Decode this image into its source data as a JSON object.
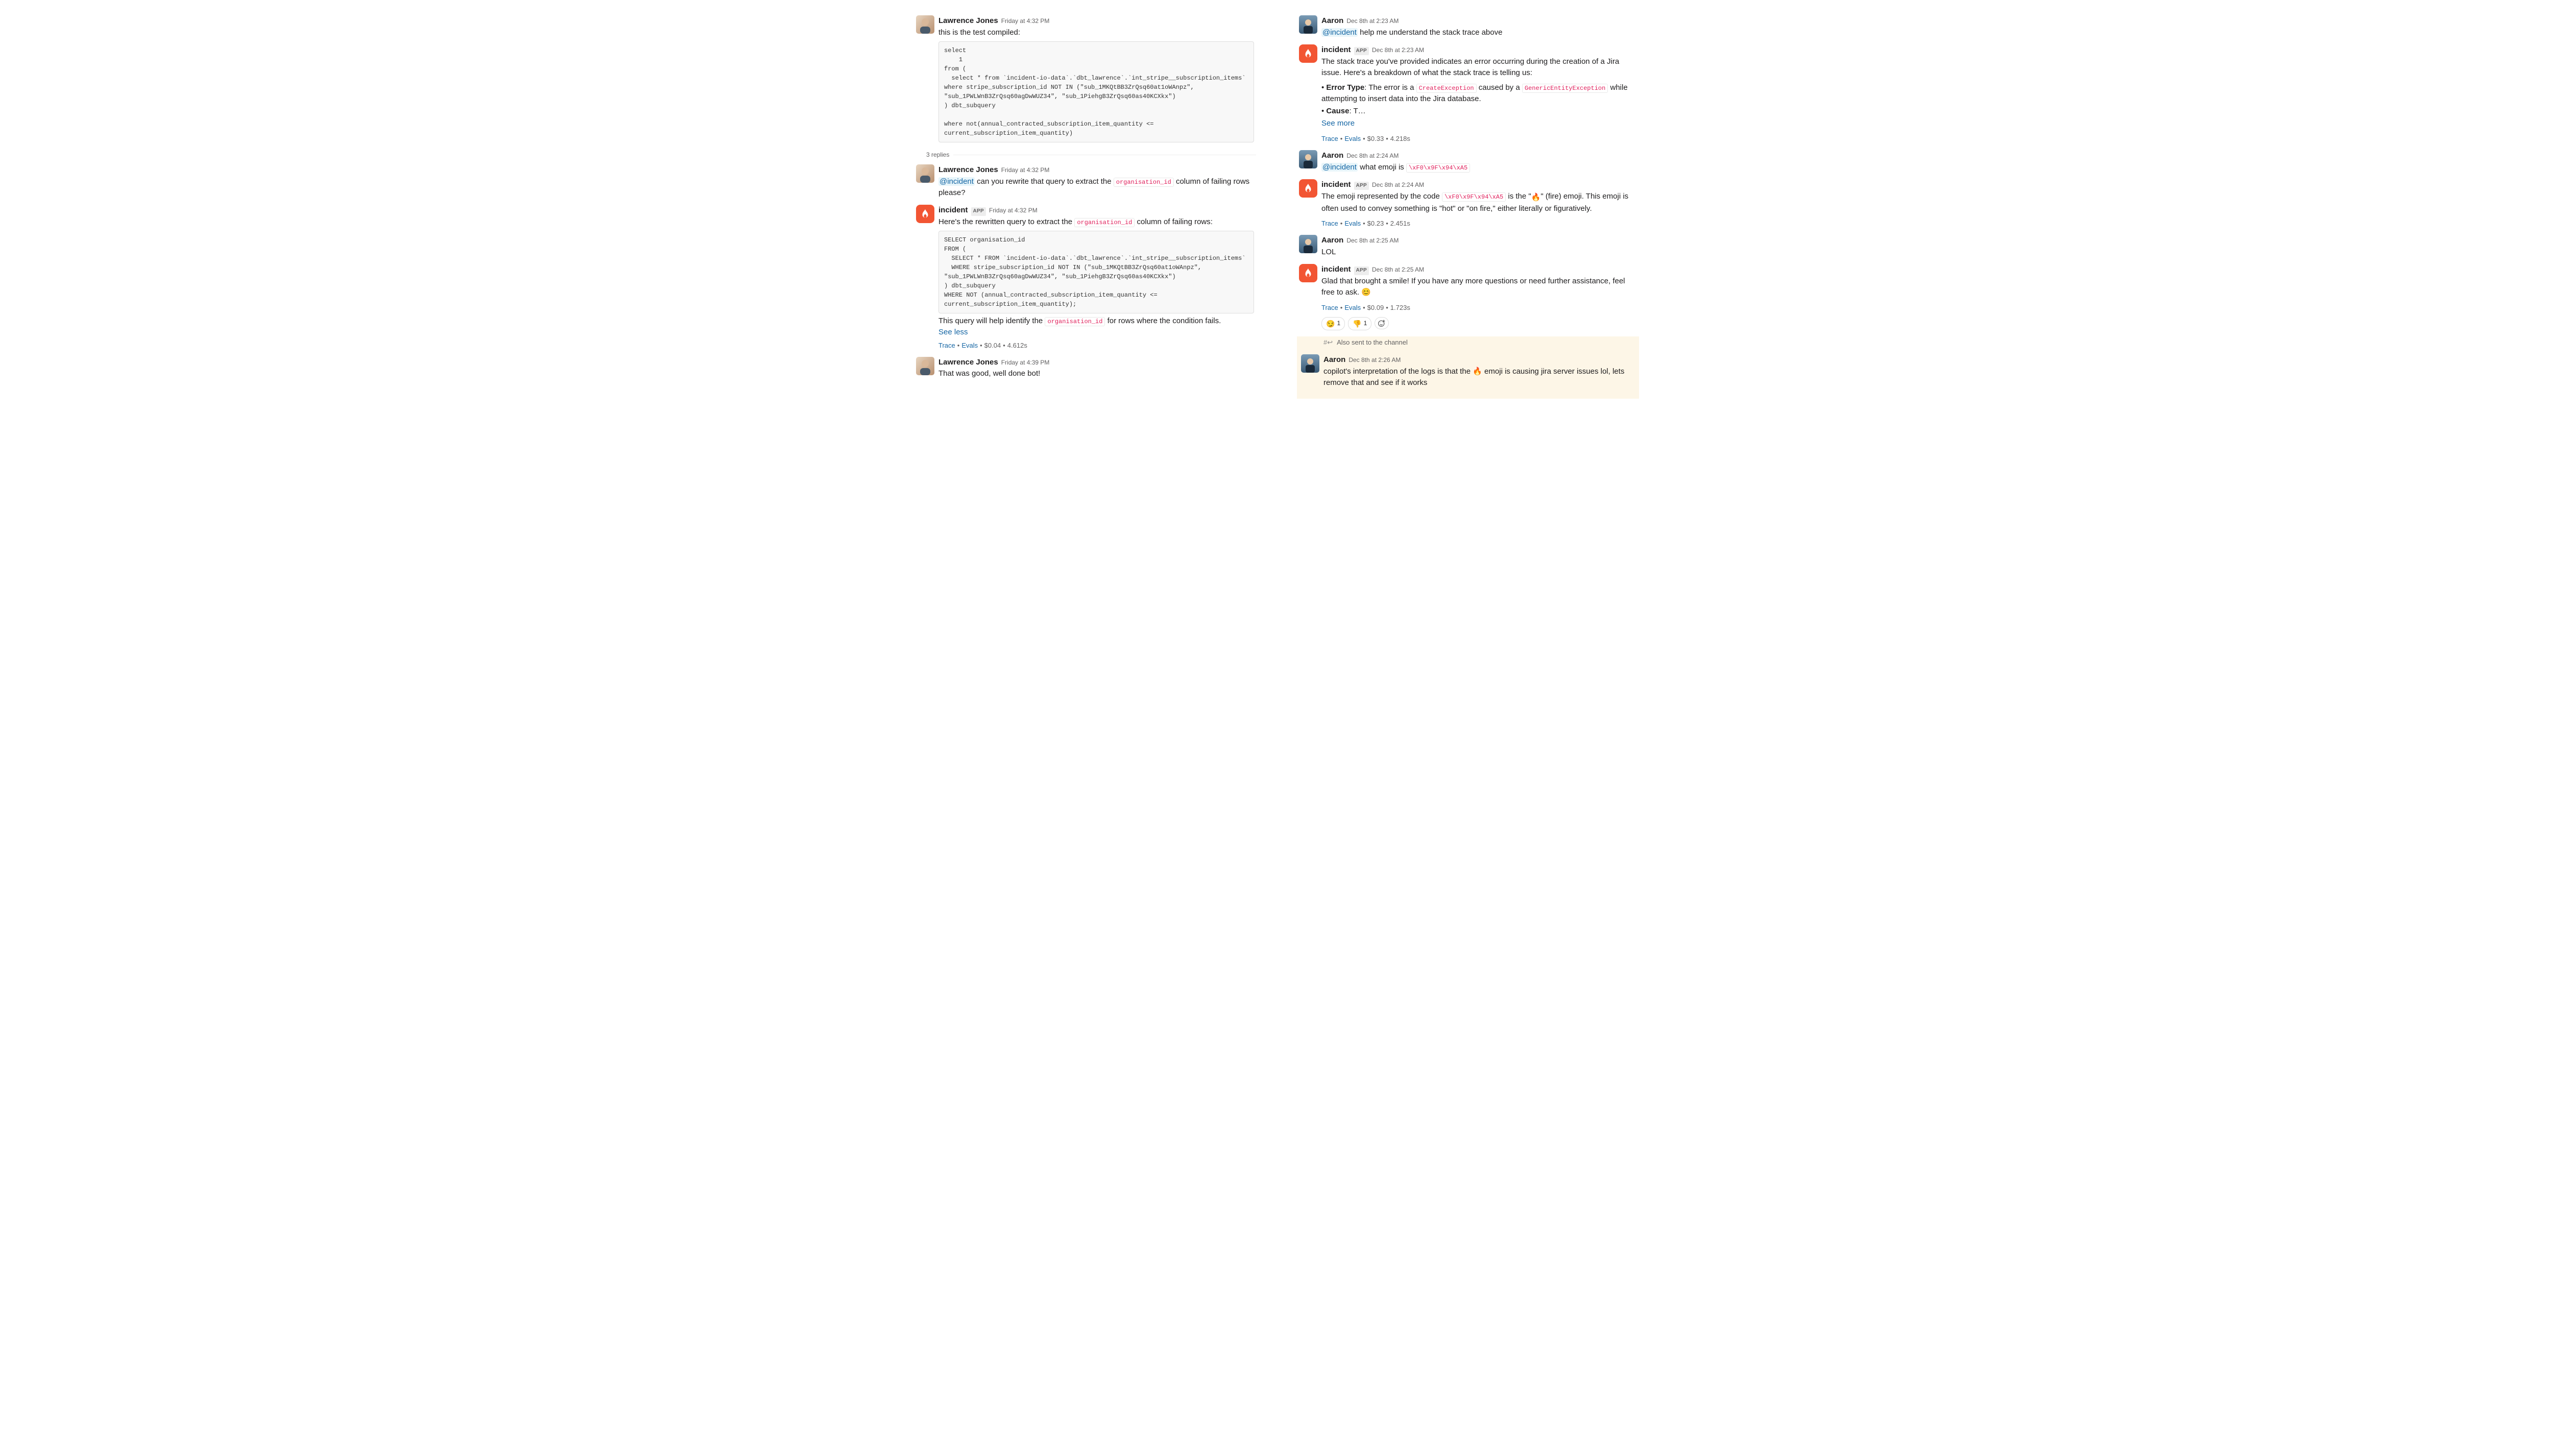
{
  "left": {
    "m1": {
      "author": "Lawrence Jones",
      "ts": "Friday at 4:32 PM",
      "text": "this is the test compiled:",
      "code": "select\n    1\nfrom (\n  select * from `incident-io-data`.`dbt_lawrence`.`int_stripe__subscription_items` where stripe_subscription_id NOT IN (\"sub_1MKQtBB3ZrQsq60at1oWAnpz\", \"sub_1PWLWnB3ZrQsq60agDwWUZ34\", \"sub_1PiehgB3ZrQsq60as40KCXkx\")\n) dbt_subquery\n\nwhere not(annual_contracted_subscription_item_quantity <= current_subscription_item_quantity)"
    },
    "thread_label": "3 replies",
    "m2": {
      "author": "Lawrence Jones",
      "ts": "Friday at 4:32 PM",
      "mention": "@incident",
      "text_after_mention": " can you rewrite that query to extract the ",
      "code_inline": "organisation_id",
      "text_tail": " column of failing rows please?"
    },
    "m3": {
      "author": "incident",
      "app": "APP",
      "ts": "Friday at 4:32 PM",
      "lead": "Here's the rewritten query to extract the ",
      "lead_code": "organisation_id",
      "lead_tail": " column of failing rows:",
      "code": "SELECT organisation_id\nFROM (\n  SELECT * FROM `incident-io-data`.`dbt_lawrence`.`int_stripe__subscription_items`\n  WHERE stripe_subscription_id NOT IN (\"sub_1MKQtBB3ZrQsq60at1oWAnpz\", \"sub_1PWLWnB3ZrQsq60agDwWUZ34\", \"sub_1PiehgB3ZrQsq60as40KCXkx\")\n) dbt_subquery\nWHERE NOT (annual_contracted_subscription_item_quantity <= current_subscription_item_quantity);",
      "foot_pre": "This query will help identify the ",
      "foot_code": "organisation_id",
      "foot_post": " for rows where the condition fails.",
      "see_less": "See less",
      "meta": {
        "trace": "Trace",
        "evals": "Evals",
        "cost": "$0.04",
        "dur": "4.612s"
      }
    },
    "m4": {
      "author": "Lawrence Jones",
      "ts": "Friday at 4:39 PM",
      "text": "That was good, well done bot!"
    }
  },
  "right": {
    "r1": {
      "author": "Aaron",
      "ts": "Dec 8th at 2:23 AM",
      "mention": "@incident",
      "text": " help me understand the stack trace above"
    },
    "r2": {
      "author": "incident",
      "app": "APP",
      "ts": "Dec 8th at 2:23 AM",
      "p1": "The stack trace you've provided indicates an error occurring during the creation of a Jira issue. Here's a breakdown of what the stack trace is telling us:",
      "b1_label": "Error Type",
      "b1_pre": ": The error is a ",
      "b1_code1": "CreateException",
      "b1_mid": " caused by a ",
      "b1_code2": "GenericEntityException",
      "b1_post": " while attempting to insert data into the Jira database.",
      "b2_label": "Cause",
      "b2_text": ": T…",
      "see_more": "See more",
      "meta": {
        "trace": "Trace",
        "evals": "Evals",
        "cost": "$0.33",
        "dur": "4.218s"
      }
    },
    "r3": {
      "author": "Aaron",
      "ts": "Dec 8th at 2:24 AM",
      "mention": "@incident",
      "text_pre": " what emoji is ",
      "code": "\\xF0\\x9F\\x94\\xA5"
    },
    "r4": {
      "author": "incident",
      "app": "APP",
      "ts": "Dec 8th at 2:24 AM",
      "pre": "The emoji represented by the code ",
      "code": "\\xF0\\x9F\\x94\\xA5",
      "mid": " is the \"",
      "emoji": "🔥",
      "post": "\" (fire) emoji. This emoji is often used to convey something is \"hot\" or \"on fire,\" either literally or figuratively.",
      "meta": {
        "trace": "Trace",
        "evals": "Evals",
        "cost": "$0.23",
        "dur": "2.451s"
      }
    },
    "r5": {
      "author": "Aaron",
      "ts": "Dec 8th at 2:25 AM",
      "text": "LOL"
    },
    "r6": {
      "author": "incident",
      "app": "APP",
      "ts": "Dec 8th at 2:25 AM",
      "text": "Glad that brought a smile! If you have any more questions or need further assistance, feel free to ask. 😊",
      "meta": {
        "trace": "Trace",
        "evals": "Evals",
        "cost": "$0.09",
        "dur": "1.723s"
      },
      "reactions": [
        {
          "emoji": "😏",
          "count": "1"
        },
        {
          "emoji": "👎",
          "count": "1"
        }
      ]
    },
    "channel_notice": "Also sent to the channel",
    "r7": {
      "author": "Aaron",
      "ts": "Dec 8th at 2:26 AM",
      "pre": "copilot's interpretation of the logs is that the ",
      "emoji": "🔥",
      "post": " emoji is causing jira server issues lol, lets remove that and see if it works"
    }
  }
}
